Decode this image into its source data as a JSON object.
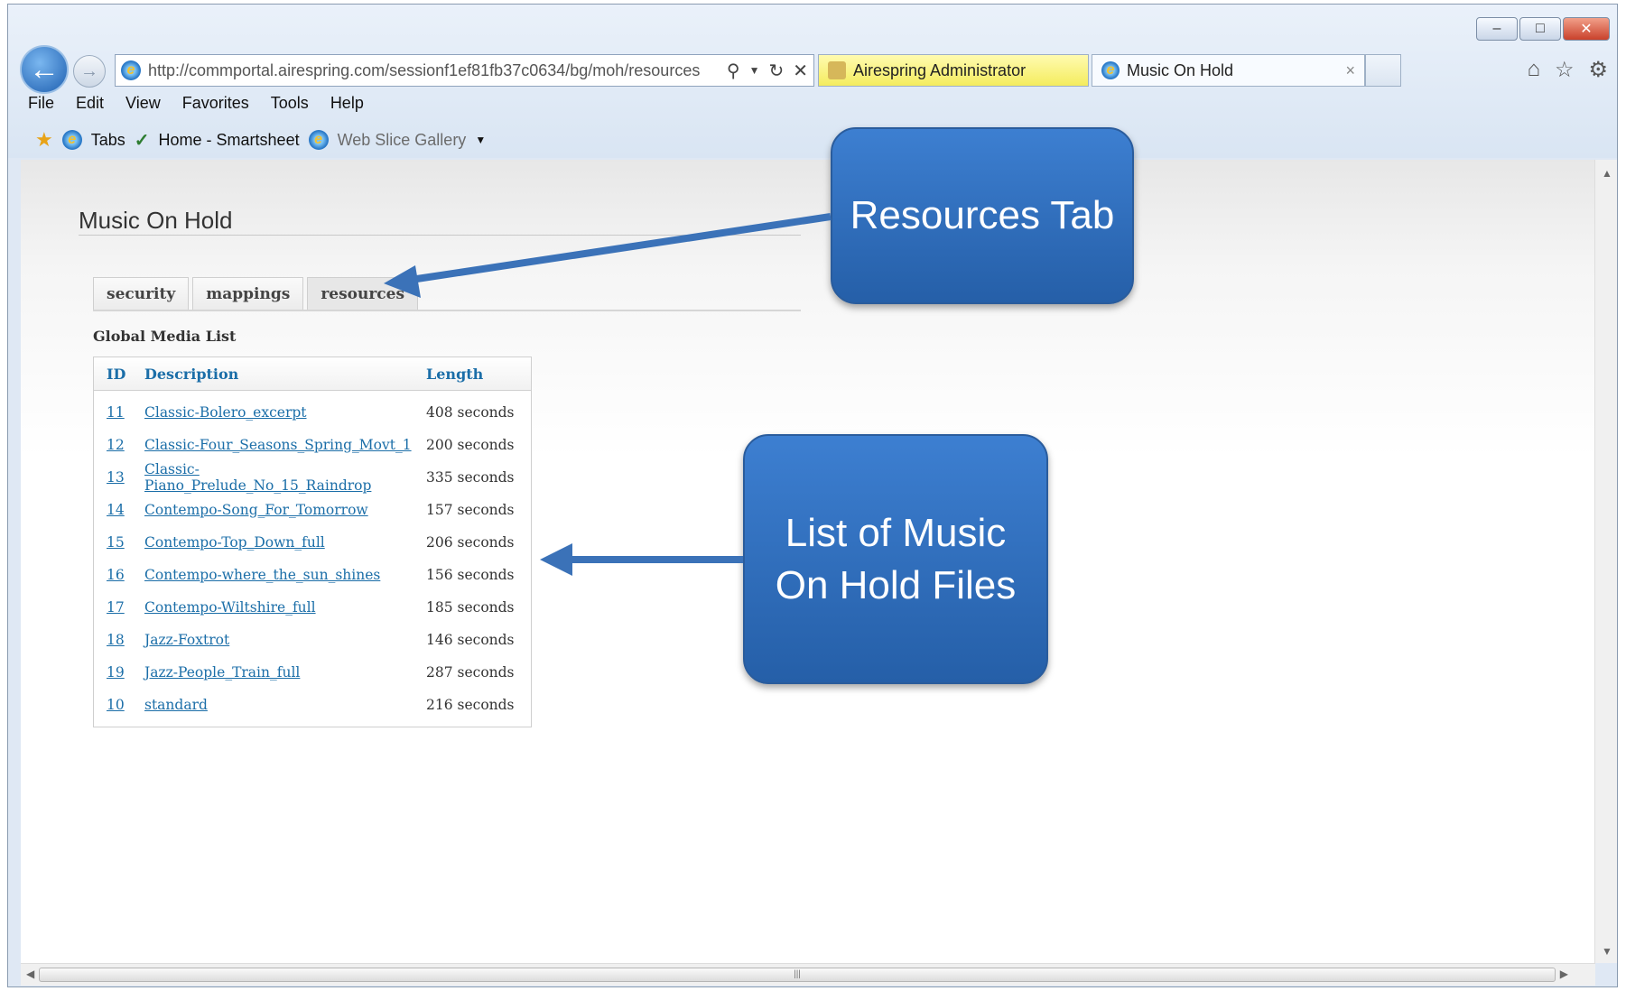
{
  "browser": {
    "url": "http://commportal.airespring.com/sessionf1ef81fb37c0634/bg/moh/resources",
    "tabs": [
      {
        "label": "Airespring Administrator"
      },
      {
        "label": "Music On Hold",
        "close": "×"
      }
    ],
    "menu": [
      "File",
      "Edit",
      "View",
      "Favorites",
      "Tools",
      "Help"
    ],
    "favorites": {
      "tabs": "Tabs",
      "home": "Home - Smartsheet",
      "webslice": "Web Slice Gallery"
    }
  },
  "page": {
    "title": "Music On Hold",
    "tabs": [
      "security",
      "mappings",
      "resources"
    ],
    "active_tab": "resources",
    "section_title": "Global Media List",
    "table": {
      "headers": [
        "ID",
        "Description",
        "Length"
      ],
      "rows": [
        {
          "id": "11",
          "description": "Classic-Bolero_excerpt",
          "length": "408 seconds"
        },
        {
          "id": "12",
          "description": "Classic-Four_Seasons_Spring_Movt_1",
          "length": "200 seconds"
        },
        {
          "id": "13",
          "description": "Classic-Piano_Prelude_No_15_Raindrop",
          "length": "335 seconds"
        },
        {
          "id": "14",
          "description": "Contempo-Song_For_Tomorrow",
          "length": "157 seconds"
        },
        {
          "id": "15",
          "description": "Contempo-Top_Down_full",
          "length": "206 seconds"
        },
        {
          "id": "16",
          "description": "Contempo-where_the_sun_shines",
          "length": "156 seconds"
        },
        {
          "id": "17",
          "description": "Contempo-Wiltshire_full",
          "length": "185 seconds"
        },
        {
          "id": "18",
          "description": "Jazz-Foxtrot",
          "length": "146 seconds"
        },
        {
          "id": "19",
          "description": "Jazz-People_Train_full",
          "length": "287 seconds"
        },
        {
          "id": "10",
          "description": "standard",
          "length": "216 seconds"
        }
      ]
    }
  },
  "callouts": {
    "resources_tab": "Resources Tab",
    "music_list_line1": "List of Music",
    "music_list_line2": "On Hold Files"
  },
  "colors": {
    "link": "#1b6ea8",
    "callout": "#2f6fbd",
    "active_tab_yellow": "#f4ec5e"
  }
}
